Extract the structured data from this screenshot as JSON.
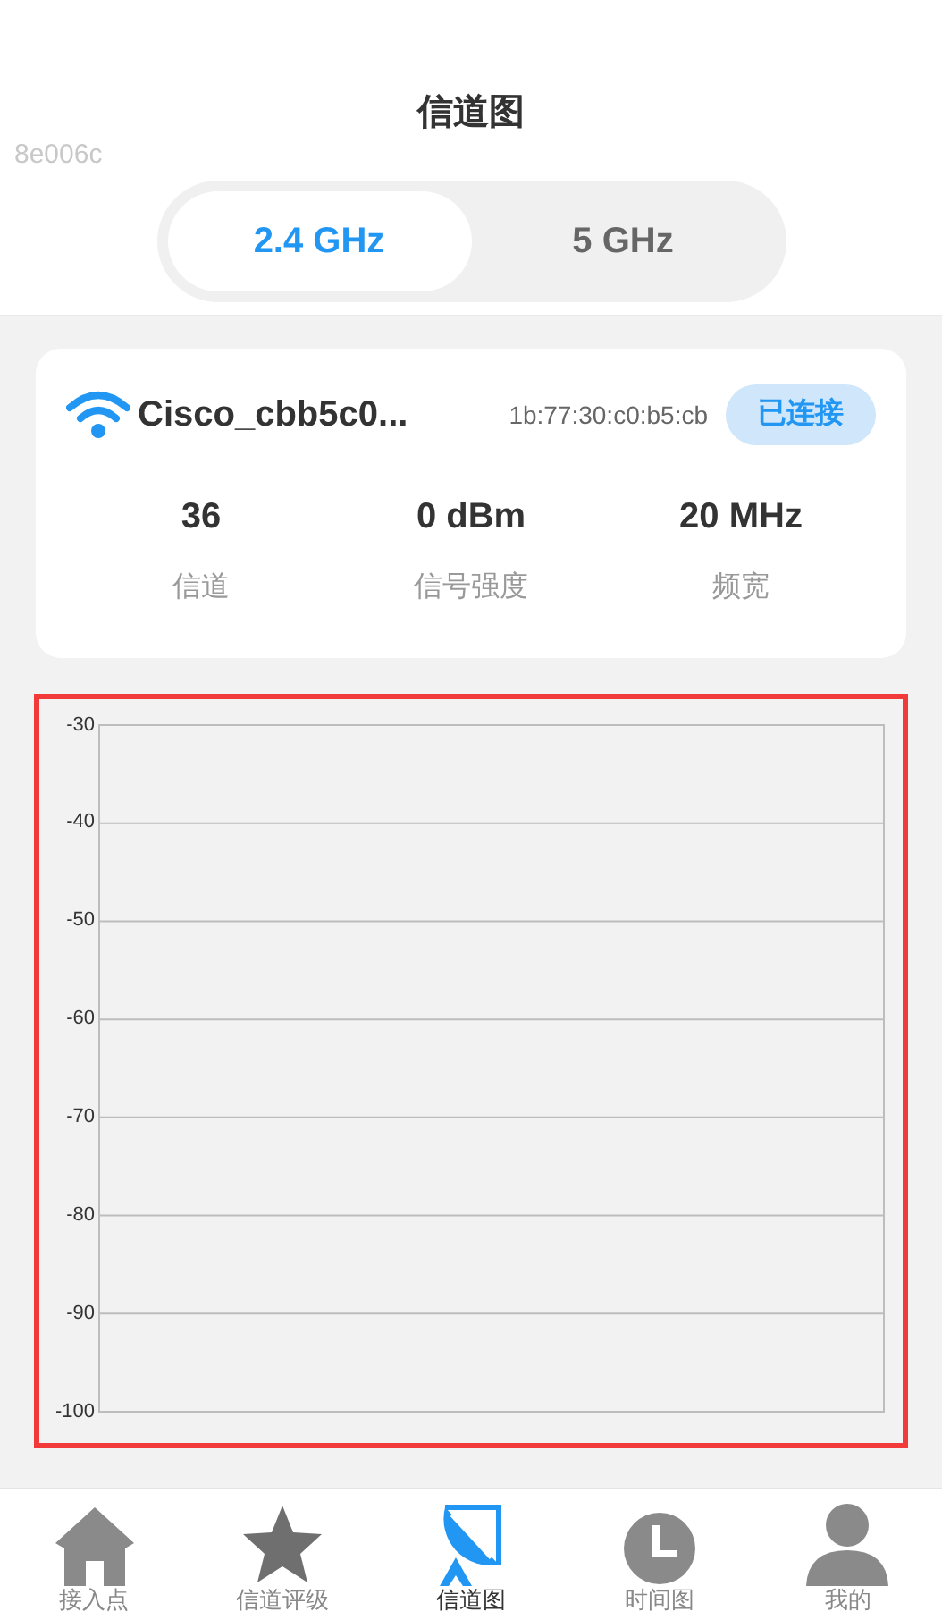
{
  "header": {
    "title": "信道图",
    "device_code": "8e006c"
  },
  "bands": [
    {
      "label": "2.4 GHz",
      "selected": true
    },
    {
      "label": "5 GHz",
      "selected": false
    }
  ],
  "network": {
    "ssid": "Cisco_cbb5c0...",
    "bssid": "1b:77:30:c0:b5:cb",
    "status": "已连接",
    "connected": true,
    "stats": [
      {
        "value": "36",
        "label": "信道"
      },
      {
        "value": "0 dBm",
        "label": "信号强度"
      },
      {
        "value": "20 MHz",
        "label": "频宽"
      }
    ]
  },
  "chart": {
    "highlighted": true,
    "y_axis_labels": [
      "-30",
      "-40",
      "-50",
      "-60",
      "-70",
      "-80",
      "-90",
      "-100"
    ]
  },
  "nav": [
    {
      "kind": "home",
      "label": "接入点",
      "selected": false
    },
    {
      "kind": "star",
      "label": "信道评级",
      "selected": false
    },
    {
      "kind": "dish",
      "label": "信道图",
      "selected": true
    },
    {
      "kind": "clock",
      "label": "时间图",
      "selected": false
    },
    {
      "kind": "person",
      "label": "我的",
      "selected": false
    }
  ]
}
